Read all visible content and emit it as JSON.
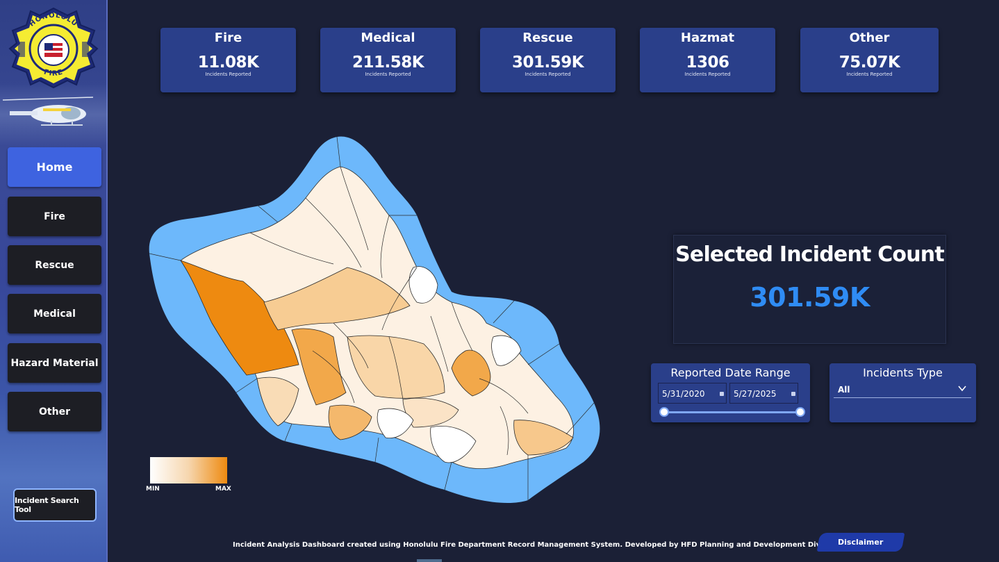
{
  "logo": {
    "top_text": "HONOLULU",
    "bottom_text": "FIRE"
  },
  "nav": {
    "items": [
      {
        "label": "Home",
        "active": true
      },
      {
        "label": "Fire",
        "active": false
      },
      {
        "label": "Rescue",
        "active": false
      },
      {
        "label": "Medical",
        "active": false
      },
      {
        "label": "Hazard Material",
        "active": false
      },
      {
        "label": "Other",
        "active": false
      }
    ],
    "search_tool": "Incident Search Tool"
  },
  "kpis": [
    {
      "title": "Fire",
      "value": "11.08K",
      "sub": "Incidents Reported"
    },
    {
      "title": "Medical",
      "value": "211.58K",
      "sub": "Incidents Reported"
    },
    {
      "title": "Rescue",
      "value": "301.59K",
      "sub": "Incidents Reported"
    },
    {
      "title": "Hazmat",
      "value": "1306",
      "sub": "Incidents Reported"
    },
    {
      "title": "Other",
      "value": "75.07K",
      "sub": "Incidents Reported"
    }
  ],
  "map": {
    "legend_min": "MIN",
    "legend_max": "MAX",
    "colors": {
      "ocean": "#6db8fb",
      "max": "#ee8a10",
      "min": "#ffffff"
    }
  },
  "selected": {
    "title": "Selected Incident Count",
    "value": "301.59K"
  },
  "date_range": {
    "title": "Reported Date Range",
    "start": "5/31/2020",
    "end": "5/27/2025"
  },
  "incident_type": {
    "title": "Incidents Type",
    "value": "All"
  },
  "footer": {
    "text": "Incident Analysis Dashboard created using Honolulu Fire Department Record Management System. Developed by HFD  Planning and Development Division 2025.",
    "disclaimer": "Disclaimer"
  },
  "icons": [
    "calendar-icon",
    "chevron-down-icon"
  ]
}
